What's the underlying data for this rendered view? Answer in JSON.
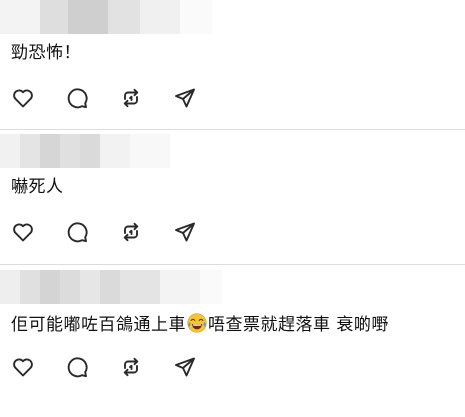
{
  "comments": [
    {
      "author": "",
      "text": "勁恐怖！",
      "actions": [
        "heart-icon",
        "comment-icon",
        "repost-icon",
        "share-icon"
      ]
    },
    {
      "author": "",
      "text": "嚇死人",
      "actions": [
        "heart-icon",
        "comment-icon",
        "repost-icon",
        "share-icon"
      ]
    },
    {
      "author": "",
      "text_before_emoji": "佢可能嘟咗百鴿通上車",
      "emoji": "face-with-tears-of-joy",
      "text_after_emoji": "唔查票就趕落車 衰啲嘢",
      "actions": [
        "heart-icon",
        "comment-icon",
        "repost-icon",
        "share-icon"
      ]
    }
  ],
  "colors": {
    "text": "#101010",
    "icon": "#2a2a2a",
    "divider": "#dcdcdc"
  }
}
